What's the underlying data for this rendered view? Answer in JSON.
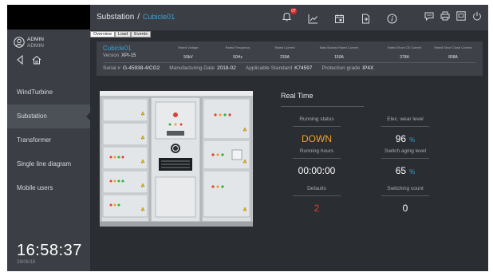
{
  "user": {
    "name": "ADMIN",
    "role": "ADMIN"
  },
  "sidebar": {
    "items": [
      {
        "label": "WindTurbine",
        "active": false
      },
      {
        "label": "Substation",
        "active": true
      },
      {
        "label": "Transformer",
        "active": false
      },
      {
        "label": "Single line diagram",
        "active": false
      },
      {
        "label": "Mobile users",
        "active": false
      }
    ],
    "time": "16:58:37",
    "date": "29/06/18"
  },
  "header": {
    "section": "Substation",
    "separator": "/",
    "current": "Cubicle01",
    "notification_count": "07"
  },
  "tabs": [
    {
      "label": "Overview",
      "active": true
    },
    {
      "label": "Load",
      "active": false
    },
    {
      "label": "Events",
      "active": false
    }
  ],
  "info": {
    "name": "Cubicle01",
    "version_label": "Version",
    "version": "XPI-15",
    "rated": [
      {
        "label": "Rated Voltage",
        "value": "50kV"
      },
      {
        "label": "Rated Frequency",
        "value": "50Hz"
      },
      {
        "label": "Rated Current",
        "value": "230A"
      },
      {
        "label": "Main Busbar Rated Current",
        "value": "150A"
      },
      {
        "label": "Rated Short CB Current",
        "value": "378A"
      },
      {
        "label": "Rated Short Close Current",
        "value": "808A"
      }
    ],
    "serial_label": "Serial #",
    "serial": "G-45938-4/CG2",
    "mfg_label": "Manufacturing Date",
    "mfg": "2018-02",
    "std_label": "Applicable Standard",
    "std": "K74597",
    "protection_label": "Protection grade",
    "protection": "IP4X"
  },
  "realtime": {
    "title": "Real Time",
    "running_status_label": "Running status",
    "running_status": "DOWN",
    "running_hours_label": "Running hours",
    "running_hours": "00:00:00",
    "defaults_label": "Defaults",
    "defaults": "2",
    "elec_wear_label": "Elec. wear level",
    "elec_wear": "96",
    "elec_wear_unit": "%",
    "switch_aging_label": "Switch aging level",
    "switch_aging": "65",
    "switch_aging_unit": "%",
    "switching_count_label": "Switching count",
    "switching_count": "0"
  },
  "colors": {
    "accent": "#3aa0d8",
    "status_down": "#f0a030",
    "defaults": "#e0402c",
    "notification": "#d62b2b"
  }
}
